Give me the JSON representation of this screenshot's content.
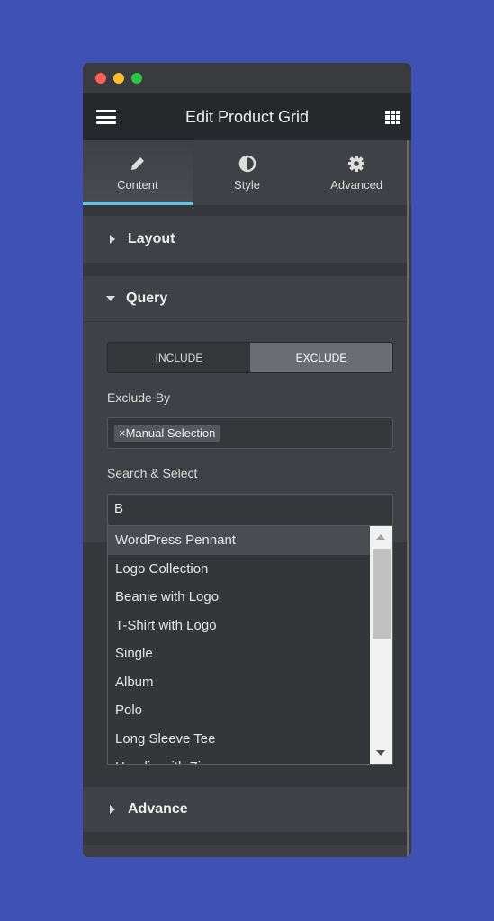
{
  "window": {
    "controls": {
      "close": "#fe5f57",
      "minimize": "#febc2e",
      "maximize": "#28c840"
    }
  },
  "header": {
    "title": "Edit Product Grid",
    "menu_icon": "hamburger-icon",
    "apps_icon": "grid-icon"
  },
  "tabs": [
    {
      "label": "Content",
      "icon": "pencil-icon",
      "active": true
    },
    {
      "label": "Style",
      "icon": "contrast-icon"
    },
    {
      "label": "Advanced",
      "icon": "gear-icon"
    }
  ],
  "accent": "#5bc7f0",
  "sections": {
    "layout": "Layout",
    "query": "Query",
    "advance": "Advance"
  },
  "query": {
    "toggle": [
      "INCLUDE",
      "EXCLUDE"
    ],
    "toggle_selected": "EXCLUDE",
    "exclude_by_label": "Exclude By",
    "exclude_by_chip": "Manual Selection",
    "chip_remove": "×",
    "search_label": "Search & Select",
    "search_value": "B",
    "options": [
      "WordPress Pennant",
      "Logo Collection",
      "Beanie with Logo",
      "T-Shirt with Logo",
      "Single",
      "Album",
      "Polo",
      "Long Sleeve Tee",
      "Hoodie with Zipper"
    ],
    "highlighted": "WordPress Pennant"
  }
}
